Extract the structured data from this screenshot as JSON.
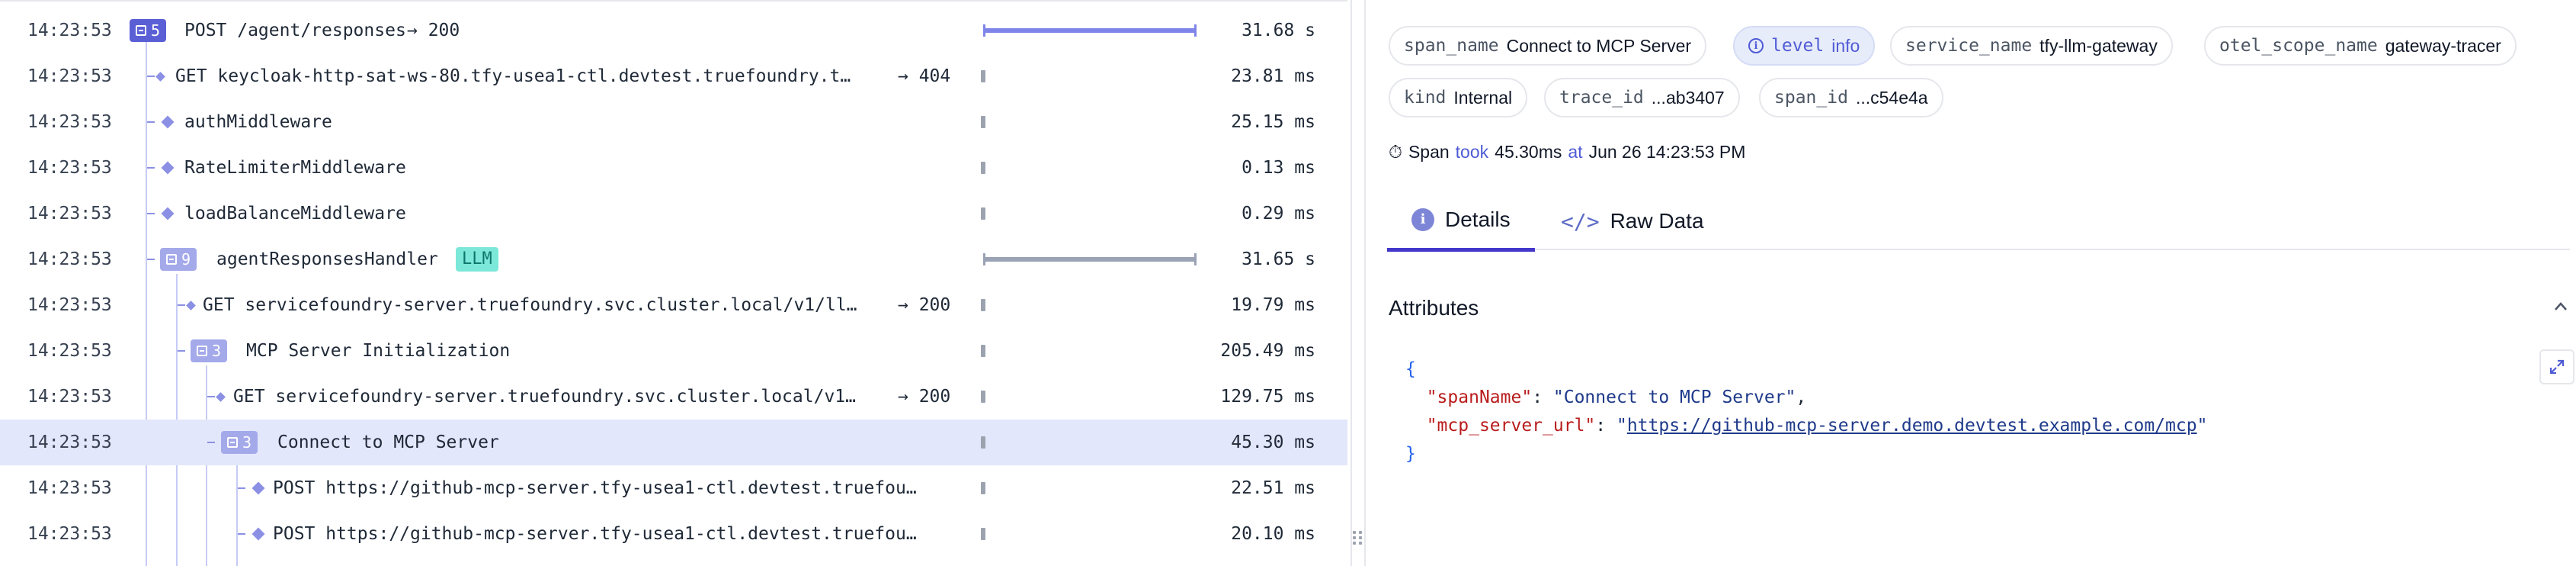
{
  "trace": {
    "rows": [
      {
        "time": "14:23:53",
        "toggle": "5",
        "name": "POST /agent/responses",
        "status": "→ 200",
        "duration": "31.68 s"
      },
      {
        "time": "14:23:53",
        "name": "GET keycloak-http-sat-ws-80.tfy-usea1-ctl.devtest.truefoundry.t…",
        "status": "→ 404",
        "duration": "23.81 ms"
      },
      {
        "time": "14:23:53",
        "name": "authMiddleware",
        "duration": "25.15 ms"
      },
      {
        "time": "14:23:53",
        "name": "RateLimiterMiddleware",
        "duration": "0.13 ms"
      },
      {
        "time": "14:23:53",
        "name": "loadBalanceMiddleware",
        "duration": "0.29 ms"
      },
      {
        "time": "14:23:53",
        "toggle": "9",
        "name": "agentResponsesHandler",
        "badge": "LLM",
        "duration": "31.65 s"
      },
      {
        "time": "14:23:53",
        "name": "GET servicefoundry-server.truefoundry.svc.cluster.local/v1/ll…",
        "status": "→ 200",
        "duration": "19.79 ms"
      },
      {
        "time": "14:23:53",
        "toggle": "3",
        "name": "MCP Server Initialization",
        "duration": "205.49 ms"
      },
      {
        "time": "14:23:53",
        "name": "GET servicefoundry-server.truefoundry.svc.cluster.local/v1…",
        "status": "→ 200",
        "duration": "129.75 ms"
      },
      {
        "time": "14:23:53",
        "toggle": "3",
        "name": "Connect to MCP Server",
        "duration": "45.30 ms"
      },
      {
        "time": "14:23:53",
        "name": "POST https://github-mcp-server.tfy-usea1-ctl.devtest.truefou…",
        "duration": "22.51 ms"
      },
      {
        "time": "14:23:53",
        "name": "POST https://github-mcp-server.tfy-usea1-ctl.devtest.truefou…",
        "duration": "20.10 ms"
      }
    ]
  },
  "details": {
    "chips": [
      {
        "key": "span_name",
        "value": "Connect to MCP Server"
      },
      {
        "key": "level",
        "value": "info"
      },
      {
        "key": "service_name",
        "value": "tfy-llm-gateway"
      },
      {
        "key": "otel_scope_name",
        "value": "gateway-tracer"
      },
      {
        "key": "kind",
        "value": "Internal"
      },
      {
        "key": "trace_id",
        "value": "...ab3407"
      },
      {
        "key": "span_id",
        "value": "...c54e4a"
      }
    ],
    "summary": {
      "icon": "⏱",
      "span": "Span",
      "took": "took",
      "duration": "45.30ms",
      "at": "at",
      "timestamp": "Jun 26 14:23:53 PM"
    },
    "tabs": [
      {
        "label": "Details"
      },
      {
        "label": "Raw Data"
      }
    ],
    "attributes_title": "Attributes",
    "json": {
      "open": "{",
      "close": "}",
      "k1": "\"spanName\"",
      "v1": "\"Connect to MCP Server\"",
      "k2": "\"mcp_server_url\"",
      "v2_q1": "\"",
      "v2_url": "https://github-mcp-server.demo.devtest.example.com/mcp",
      "v2_q2": "\""
    }
  },
  "colors": {
    "accent": "#4338ca",
    "toggle_dark": "#5b5fd6",
    "toggle_light": "#a4a9ea",
    "selected_row": "#e3e7fb",
    "badge_llm": "#7ce8d9"
  }
}
